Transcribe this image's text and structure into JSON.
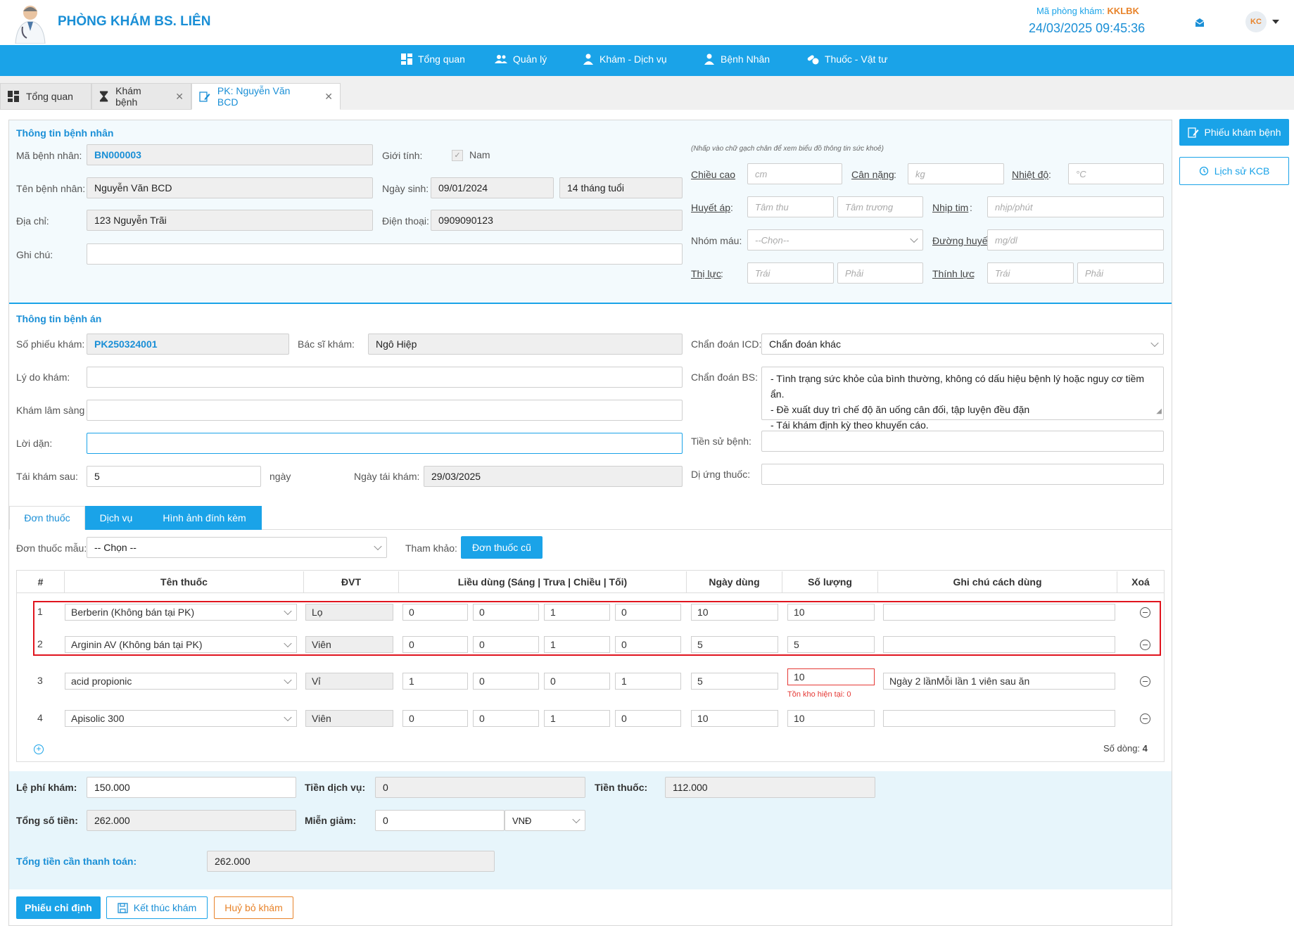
{
  "header": {
    "clinic_name": "PHÒNG KHÁM BS. LIÊN",
    "room_code_label": "Mã phòng khám:",
    "room_code": "KKLBK",
    "datetime": "24/03/2025 09:45:36",
    "avatar_text": "KC"
  },
  "nav": [
    "Tổng quan",
    "Quản lý",
    "Khám - Dịch vụ",
    "Bệnh Nhân",
    "Thuốc - Vật tư"
  ],
  "tabs": [
    {
      "label": "Tổng quan"
    },
    {
      "label": "Khám bệnh"
    },
    {
      "label": "PK: Nguyễn Văn BCD"
    }
  ],
  "side_buttons": {
    "exam_form": "Phiếu khám bệnh",
    "history": "Lịch sử KCB"
  },
  "patient": {
    "section_title": "Thông tin bệnh nhân",
    "id_label": "Mã bệnh nhân",
    "id": "BN000003",
    "gender_label": "Giới tính",
    "gender": "Nam",
    "name_label": "Tên bệnh nhân",
    "name": "Nguyễn Văn BCD",
    "dob_label": "Ngày sinh",
    "dob": "09/01/2024",
    "age": "14 tháng tuổi",
    "address_label": "Địa chỉ",
    "address": "123 Nguyễn Trãi",
    "phone_label": "Điện thoại",
    "phone": "0909090123",
    "note_label": "Ghi chú",
    "note": ""
  },
  "vitals": {
    "hint": "(Nhấp vào chữ gạch chân để xem biểu đồ thông tin sức khoẻ)",
    "height_label": "Chiều cao",
    "height_ph": "cm",
    "weight_label": "Cân nặng",
    "weight_ph": "kg",
    "temp_label": "Nhiệt độ",
    "temp_ph": "°C",
    "bp_label": "Huyết áp",
    "bp_sys_ph": "Tâm thu",
    "bp_dia_ph": "Tâm trương",
    "hr_label": "Nhịp tim",
    "hr_ph": "nhịp/phút",
    "blood_label": "Nhóm máu",
    "blood_ph": "--Chọn--",
    "glucose_label": "Đường huyết",
    "glucose_ph": "mg/dl",
    "vision_label": "Thị lực",
    "left_ph": "Trái",
    "right_ph": "Phải",
    "hearing_label": "Thính lực"
  },
  "record": {
    "section_title": "Thông tin bệnh án",
    "form_no_label": "Số phiếu khám",
    "form_no": "PK250324001",
    "doctor_label": "Bác sĩ khám",
    "doctor": "Ngô Hiệp",
    "icd_label": "Chẩn đoán ICD",
    "icd": "Chẩn đoán khác",
    "reason_label": "Lý do khám",
    "clinical_label": "Khám lâm sàng",
    "diag_label": "Chẩn đoán BS",
    "diag_lines": [
      "- Tình trạng sức khỏe của bình thường, không có dấu hiệu bệnh lý hoặc nguy cơ tiềm ẩn.",
      "- Đề xuất duy trì chế độ ăn uống cân đối, tập luyện đều đặn",
      "- Tái khám định kỳ theo khuyến cáo."
    ],
    "advice_label": "Lời dặn",
    "history_label": "Tiền sử bệnh",
    "revisit_label": "Tái khám sau",
    "revisit": "5",
    "revisit_unit": "ngày",
    "revisit_date_label": "Ngày tái khám",
    "revisit_date": "29/03/2025",
    "allergy_label": "Dị ứng thuốc"
  },
  "rx_tabs": [
    "Đơn thuốc",
    "Dịch vụ",
    "Hình ảnh đính kèm"
  ],
  "rx": {
    "template_label": "Đơn thuốc mẫu",
    "template_value": "-- Chọn --",
    "ref_label": "Tham khảo:",
    "old_btn": "Đơn thuốc cũ",
    "headers": [
      "#",
      "Tên thuốc",
      "ĐVT",
      "Liều dùng (Sáng | Trưa | Chiều | Tối)",
      "Ngày dùng",
      "Số lượng",
      "Ghi chú cách dùng",
      "Xoá"
    ],
    "rows": [
      {
        "no": "1",
        "name": "Berberin (Không bán tại PK)",
        "unit": "Lọ",
        "d1": "0",
        "d2": "0",
        "d3": "1",
        "d4": "0",
        "days": "10",
        "qty": "10",
        "note": ""
      },
      {
        "no": "2",
        "name": "Arginin AV (Không bán tại PK)",
        "unit": "Viên",
        "d1": "0",
        "d2": "0",
        "d3": "1",
        "d4": "0",
        "days": "5",
        "qty": "5",
        "note": ""
      },
      {
        "no": "3",
        "name": "acid propionic",
        "unit": "Vỉ",
        "d1": "1",
        "d2": "0",
        "d3": "0",
        "d4": "1",
        "days": "5",
        "qty": "10",
        "note": "Ngày 2 lầnMỗi lần 1 viên sau ăn",
        "stock_warning": "Tồn kho hiện tại: 0"
      },
      {
        "no": "4",
        "name": "Apisolic 300",
        "unit": "Viên",
        "d1": "0",
        "d2": "0",
        "d3": "1",
        "d4": "0",
        "days": "10",
        "qty": "10",
        "note": ""
      }
    ],
    "row_count_label": "Số dòng:",
    "row_count": "4"
  },
  "billing": {
    "fee_label": "Lệ phí khám",
    "fee": "150.000",
    "service_label": "Tiền dịch vụ",
    "service": "0",
    "drug_label": "Tiền thuốc",
    "drug": "112.000",
    "total_label": "Tổng số tiền",
    "total": "262.000",
    "discount_label": "Miễn giảm",
    "discount": "0",
    "currency": "VNĐ",
    "payable_label": "Tổng tiền cần thanh toán",
    "payable": "262.000"
  },
  "actions": {
    "order": "Phiếu chỉ định",
    "finish": "Kết thúc khám",
    "cancel": "Huỷ bỏ khám"
  },
  "colors": {
    "primary": "#1aa3e8",
    "accent_text": "#1a8fd6",
    "highlight_red": "#e0141e",
    "orange": "#e8832a"
  }
}
